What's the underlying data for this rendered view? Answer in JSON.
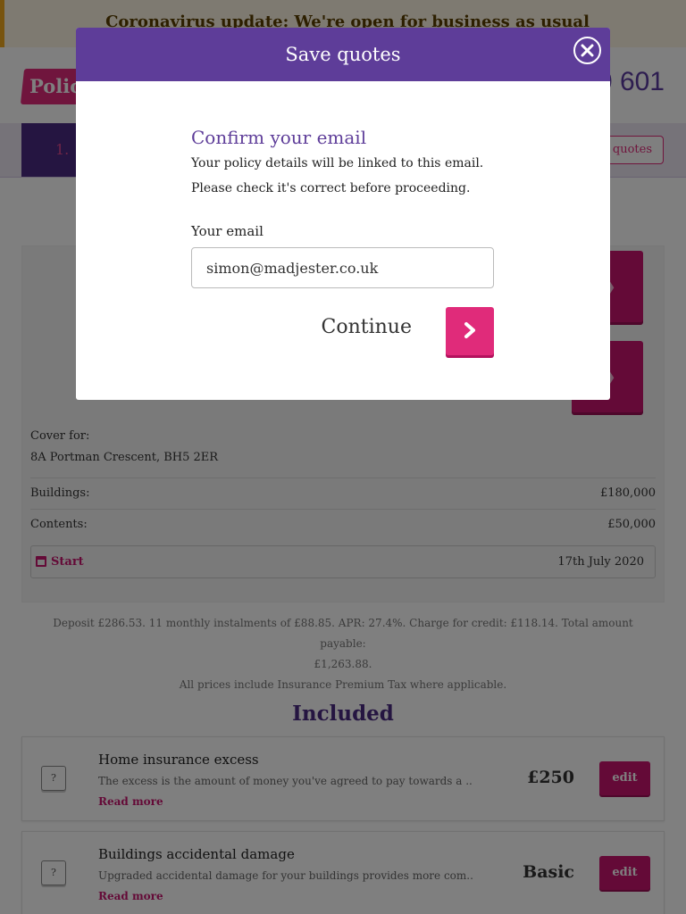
{
  "banner": {
    "text": "Coronavirus update: We're open for business as usual"
  },
  "header": {
    "logo_text": "Polic",
    "phone": "0 601"
  },
  "steps": {
    "current_step": "1.",
    "save_quotes_label": "e quotes"
  },
  "quote": {
    "cover_for_label": "Cover for:",
    "address": "8A Portman Crescent, BH5 2ER",
    "buildings_label": "Buildings:",
    "buildings_value": "£180,000",
    "contents_label": "Contents:",
    "contents_value": "£50,000",
    "start_label": "Start",
    "start_value": "17th July 2020"
  },
  "finance": {
    "line1": "Deposit £286.53. 11 monthly instalments of £88.85. APR: 27.4%. Charge for credit: £118.14. Total amount payable:",
    "line2": "£1,263.88.",
    "line3": "All prices include Insurance Premium Tax where applicable."
  },
  "included": {
    "title": "Included",
    "items": [
      {
        "title": "Home insurance excess",
        "description": "The excess is the amount of money you've agreed to pay towards a ...",
        "read_more": "Read more",
        "value": "£250",
        "edit_label": "edit",
        "help_label": "?"
      },
      {
        "title": "Buildings accidental damage",
        "description": "Upgraded accidental damage for your buildings provides more com...",
        "read_more": "Read more",
        "value": "Basic",
        "edit_label": "edit",
        "help_label": "?"
      }
    ]
  },
  "modal": {
    "title": "Save quotes",
    "heading": "Confirm your email",
    "description_line1": "Your policy details will be linked to this email.",
    "description_line2": "Please check it's correct before proceeding.",
    "email_label": "Your email",
    "email_value": "simon@madjester.co.uk",
    "continue_label": "Continue"
  },
  "colors": {
    "primary_purple": "#5e3d99",
    "accent_pink": "#e02b7a",
    "banner_bg": "#fdf4e3"
  }
}
